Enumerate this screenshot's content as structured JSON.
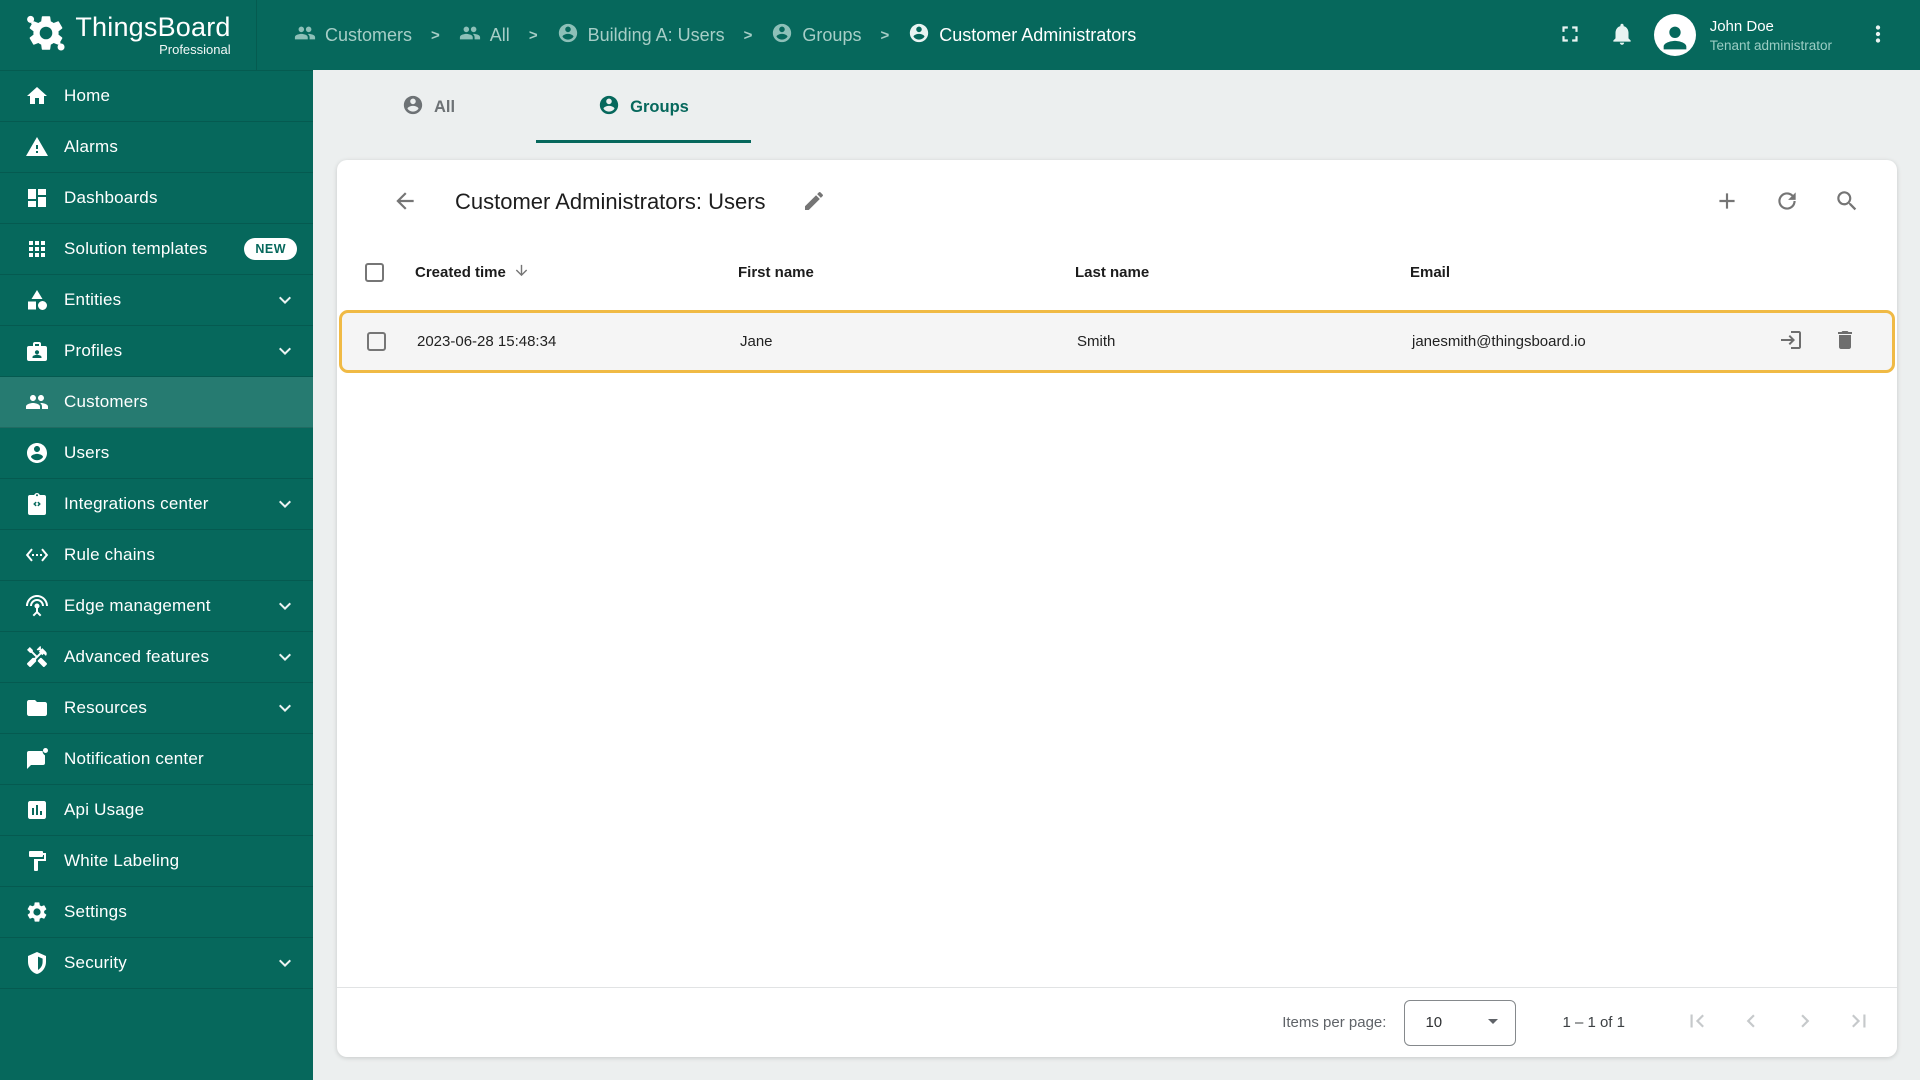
{
  "brand": {
    "name": "ThingsBoard",
    "subtitle": "Professional"
  },
  "breadcrumbs": [
    {
      "label": "Customers",
      "icon": "people"
    },
    {
      "label": "All",
      "icon": "people"
    },
    {
      "label": "Building A: Users",
      "icon": "account"
    },
    {
      "label": "Groups",
      "icon": "account"
    },
    {
      "label": "Customer Administrators",
      "icon": "account"
    }
  ],
  "header": {
    "icons": [
      "fullscreen",
      "bell",
      "more-vert"
    ],
    "user_name": "John Doe",
    "user_role": "Tenant administrator"
  },
  "sidebar": {
    "items": [
      {
        "label": "Home",
        "icon": "home"
      },
      {
        "label": "Alarms",
        "icon": "warning"
      },
      {
        "label": "Dashboards",
        "icon": "dashboard"
      },
      {
        "label": "Solution templates",
        "icon": "apps",
        "badge": "NEW"
      },
      {
        "label": "Entities",
        "icon": "category",
        "expandable": true
      },
      {
        "label": "Profiles",
        "icon": "badge",
        "expandable": true
      },
      {
        "label": "Customers",
        "icon": "people",
        "active": true
      },
      {
        "label": "Users",
        "icon": "account"
      },
      {
        "label": "Integrations center",
        "icon": "integration",
        "expandable": true
      },
      {
        "label": "Rule chains",
        "icon": "ethernet"
      },
      {
        "label": "Edge management",
        "icon": "antenna",
        "expandable": true
      },
      {
        "label": "Advanced features",
        "icon": "construction",
        "expandable": true
      },
      {
        "label": "Resources",
        "icon": "folder",
        "expandable": true
      },
      {
        "label": "Notification center",
        "icon": "notification"
      },
      {
        "label": "Api Usage",
        "icon": "chart"
      },
      {
        "label": "White Labeling",
        "icon": "paint"
      },
      {
        "label": "Settings",
        "icon": "gear"
      },
      {
        "label": "Security",
        "icon": "shield",
        "expandable": true
      }
    ]
  },
  "tabs": [
    {
      "label": "All",
      "icon": "account",
      "active": false
    },
    {
      "label": "Groups",
      "icon": "account",
      "active": true
    }
  ],
  "card": {
    "title": "Customer Administrators: Users",
    "tool_icons": [
      "plus",
      "refresh",
      "search"
    ]
  },
  "table": {
    "columns": [
      "Created time",
      "First name",
      "Last name",
      "Email"
    ],
    "sort": {
      "column": "Created time",
      "direction": "desc"
    },
    "rows": [
      {
        "created_time": "2023-06-28 15:48:34",
        "first_name": "Jane",
        "last_name": "Smith",
        "email": "janesmith@thingsboard.io",
        "row_icons": [
          "login",
          "delete"
        ]
      }
    ]
  },
  "pagination": {
    "items_per_page_label": "Items per page:",
    "items_per_page": "10",
    "range": "1 – 1 of 1",
    "controls": [
      "first-page",
      "previous-page",
      "next-page",
      "last-page"
    ]
  },
  "colors": {
    "primary": "#06685c",
    "active_item": "#22796c",
    "highlight_border": "#f0ba45",
    "content_bg": "#ecefef",
    "row_bg": "#f5f5f5"
  }
}
